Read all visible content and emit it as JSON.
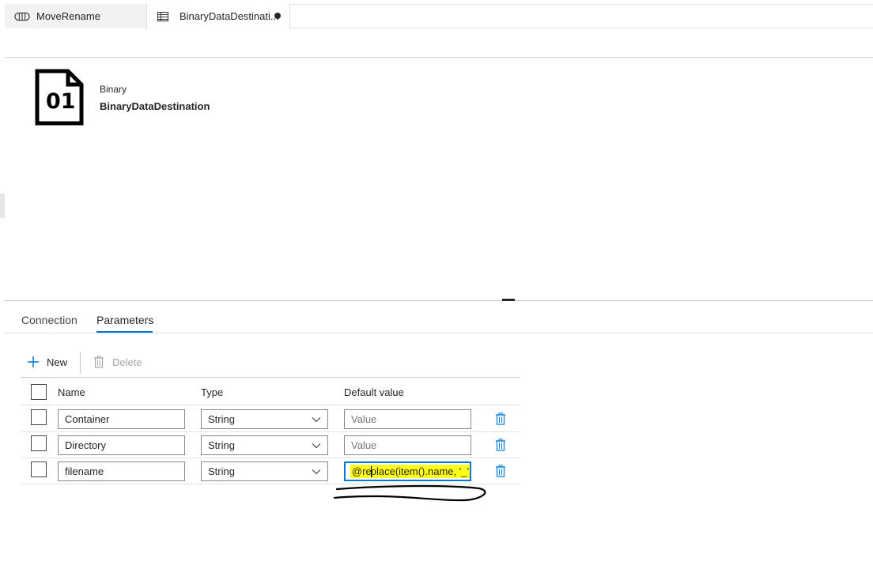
{
  "tabs": [
    {
      "label": "MoveRename"
    },
    {
      "label": "BinaryDataDestinati..."
    }
  ],
  "dataset": {
    "icon_text": "01",
    "type": "Binary",
    "name": "BinaryDataDestination"
  },
  "bottom_tabs": {
    "connection": "Connection",
    "parameters": "Parameters"
  },
  "toolbar": {
    "new_label": "New",
    "delete_label": "Delete"
  },
  "table": {
    "headers": {
      "name": "Name",
      "type": "Type",
      "default": "Default value"
    },
    "rows": [
      {
        "name": "Container",
        "type": "String",
        "default": "",
        "default_placeholder": "Value"
      },
      {
        "name": "Directory",
        "type": "String",
        "default": "",
        "default_placeholder": "Value"
      },
      {
        "name": "filename",
        "type": "String",
        "default_before_caret": "@re",
        "default_after_caret": "place(item().name, '_'"
      }
    ]
  },
  "colors": {
    "accent": "#0078d4",
    "highlight": "#ffff1a"
  }
}
